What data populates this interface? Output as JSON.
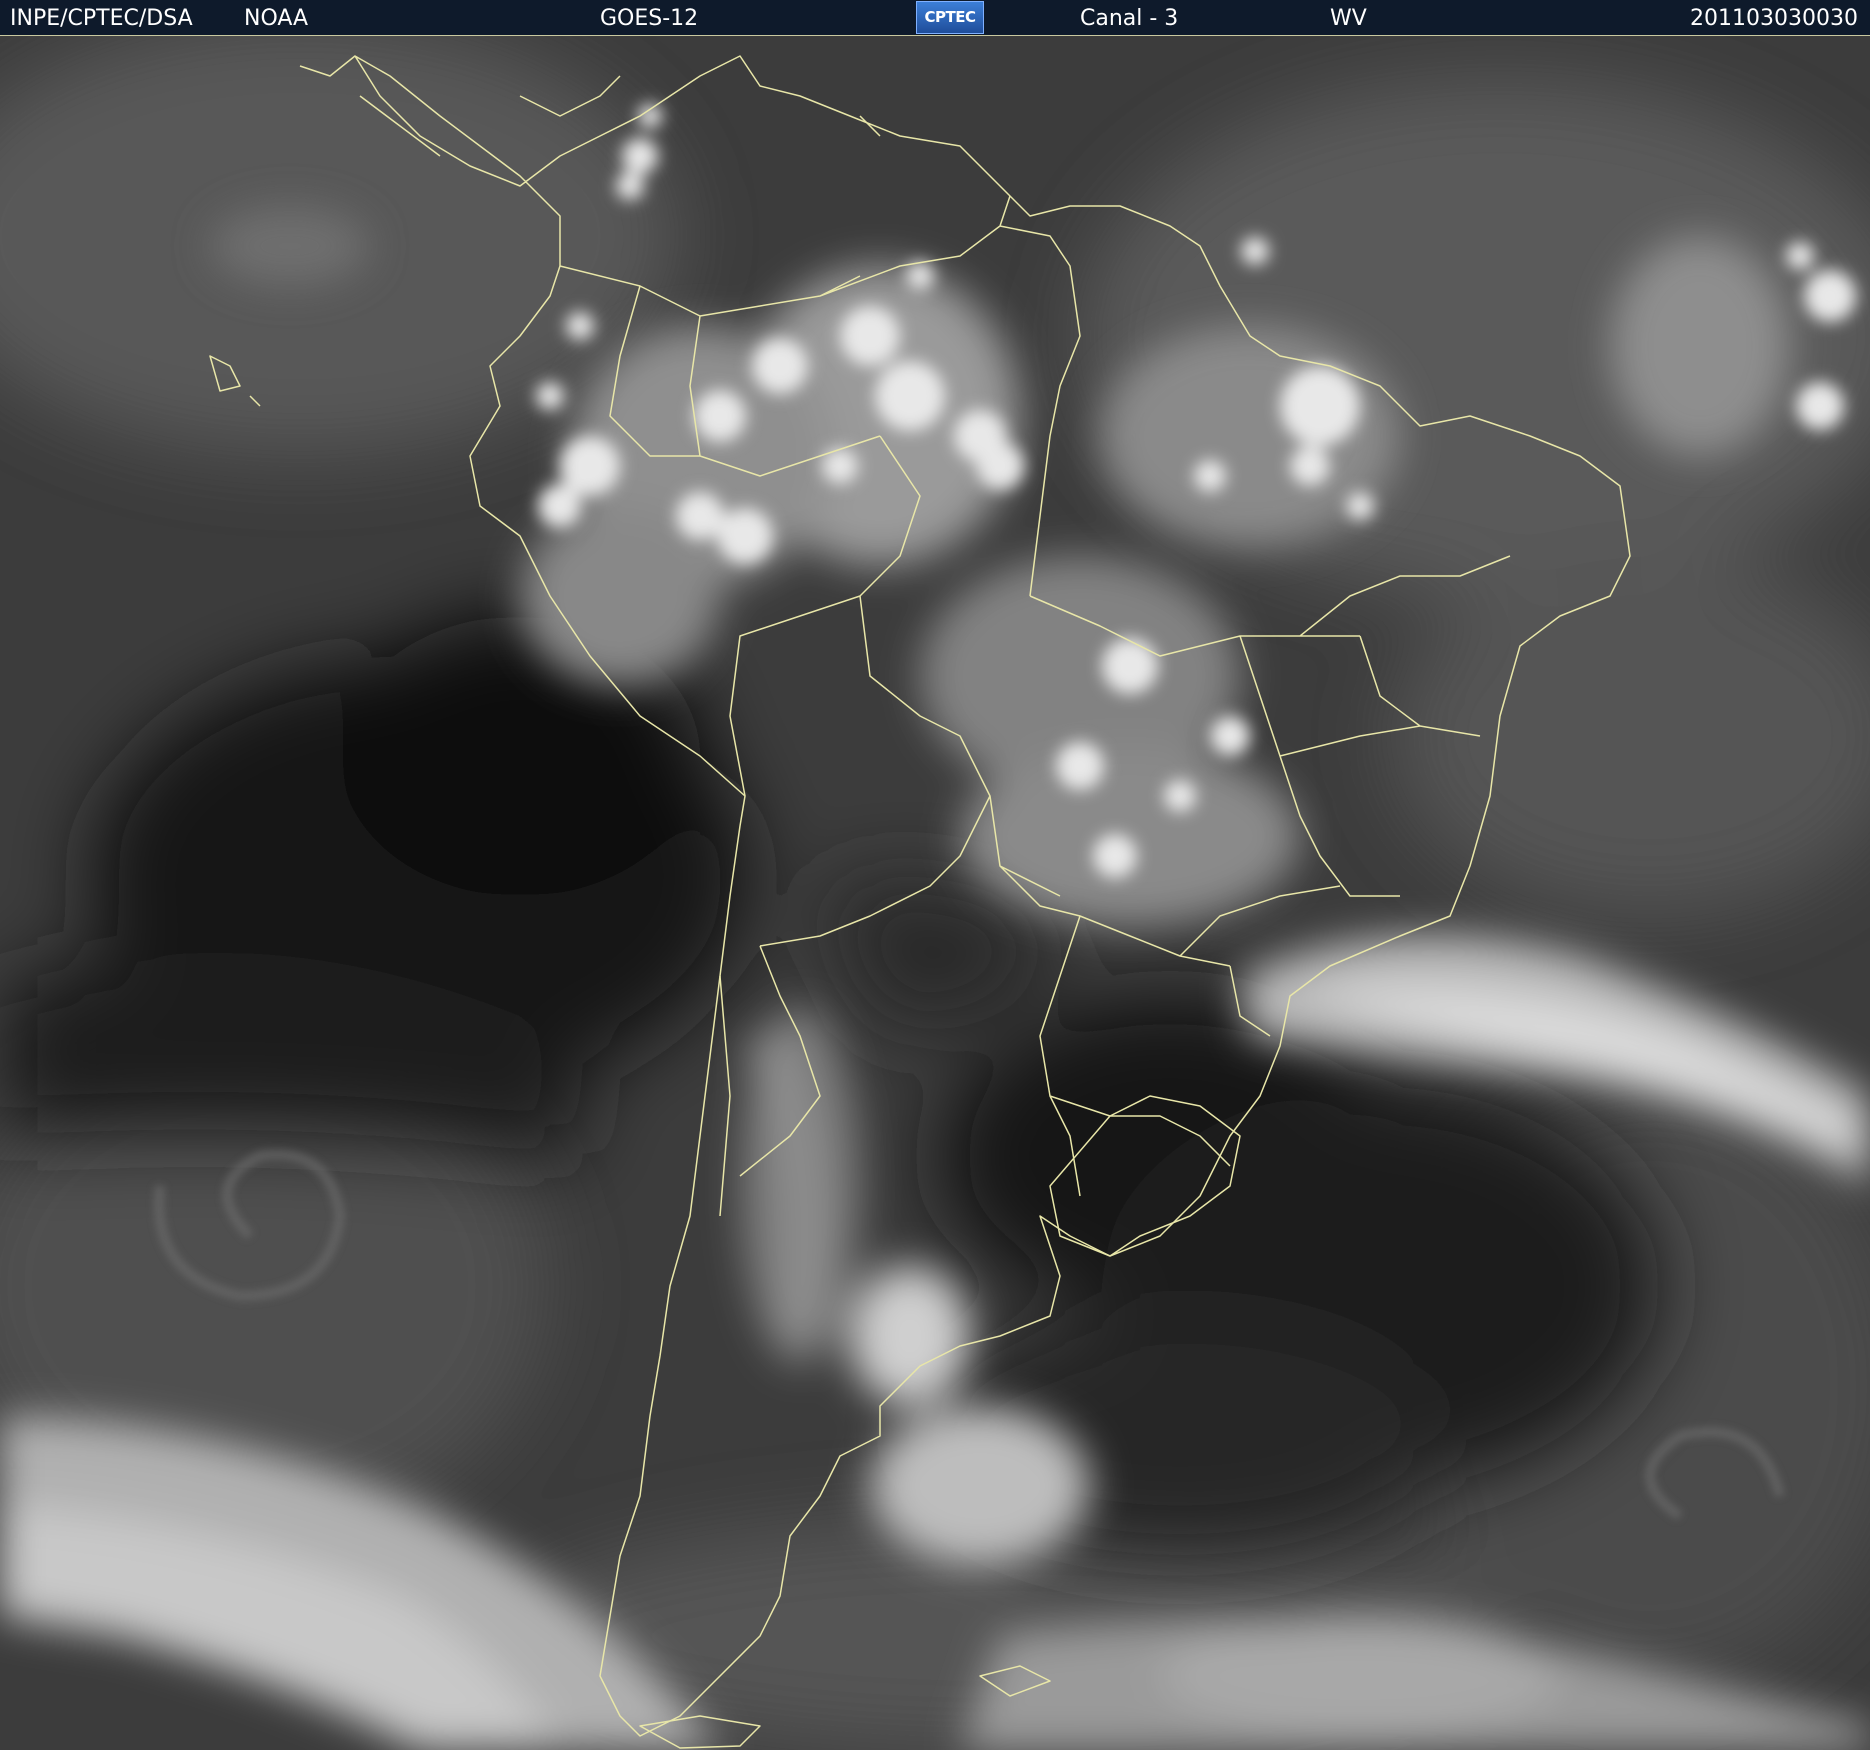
{
  "header": {
    "agency": "INPE/CPTEC/DSA",
    "operator": "NOAA",
    "satellite": "GOES-12",
    "logo_text": "CPTEC",
    "channel": "Canal - 3",
    "band": "WV",
    "timestamp": "201103030030"
  },
  "colors": {
    "header_bg": "#0e1a2b",
    "coastline": "#e8e6a8",
    "dry_air": "#0f0f0f",
    "moist_air": "#6a6a6a",
    "cloud": "#f2f2f2"
  }
}
